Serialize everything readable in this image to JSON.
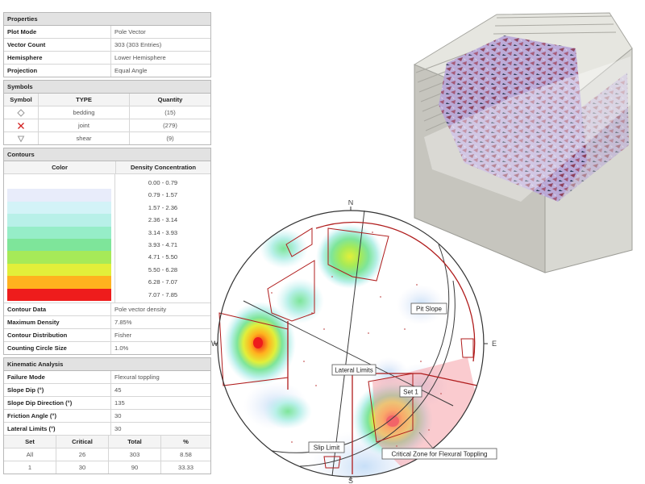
{
  "properties": {
    "title": "Properties",
    "rows": [
      {
        "key": "Plot Mode",
        "value": "Pole Vector"
      },
      {
        "key": "Vector Count",
        "value": "303 (303 Entries)"
      },
      {
        "key": "Hemisphere",
        "value": "Lower Hemisphere"
      },
      {
        "key": "Projection",
        "value": "Equal Angle"
      }
    ]
  },
  "symbols": {
    "title": "Symbols",
    "headers": [
      "Symbol",
      "TYPE",
      "Quantity"
    ],
    "rows": [
      {
        "icon": "diamond-outline-icon",
        "type": "bedding",
        "quantity": "(15)",
        "color": "#999999"
      },
      {
        "icon": "red-x-icon",
        "type": "joint",
        "quantity": "(279)",
        "color": "#d22020"
      },
      {
        "icon": "triangle-down-outline-icon",
        "type": "shear",
        "quantity": "(9)",
        "color": "#999999"
      }
    ]
  },
  "contours": {
    "title": "Contours",
    "headers": [
      "Color",
      "Density Concentration"
    ],
    "bins": [
      {
        "color": "#ffffff",
        "range": "0.00 - 0.79"
      },
      {
        "color": "#e8ecfa",
        "range": "0.79 - 1.57"
      },
      {
        "color": "#d3f3f7",
        "range": "1.57 - 2.36"
      },
      {
        "color": "#b8f0e8",
        "range": "2.36 - 3.14"
      },
      {
        "color": "#96edc8",
        "range": "3.14 - 3.93"
      },
      {
        "color": "#7ee59a",
        "range": "3.93 - 4.71"
      },
      {
        "color": "#a6ea58",
        "range": "4.71 - 5.50"
      },
      {
        "color": "#e2ef3a",
        "range": "5.50 - 6.28"
      },
      {
        "color": "#ffb21e",
        "range": "6.28 - 7.07"
      },
      {
        "color": "#ee1c1c",
        "range": "7.07 - 7.85"
      }
    ],
    "rows": [
      {
        "key": "Contour Data",
        "value": "Pole vector density"
      },
      {
        "key": "Maximum Density",
        "value": "7.85%"
      },
      {
        "key": "Contour Distribution",
        "value": "Fisher"
      },
      {
        "key": "Counting Circle Size",
        "value": "1.0%"
      }
    ]
  },
  "kinematic": {
    "title": "Kinematic Analysis",
    "rows": [
      {
        "key": "Failure Mode",
        "value": "Flexural toppling"
      },
      {
        "key": "Slope Dip (°)",
        "value": "45"
      },
      {
        "key": "Slope Dip Direction (°)",
        "value": "135"
      },
      {
        "key": "Friction Angle (°)",
        "value": "30"
      },
      {
        "key": "Lateral Limits (°)",
        "value": "30"
      }
    ],
    "table_headers": [
      "Set",
      "Critical",
      "Total",
      "%"
    ],
    "table_rows": [
      [
        "All",
        "26",
        "303",
        "8.58"
      ],
      [
        "1",
        "30",
        "90",
        "33.33"
      ]
    ]
  },
  "stereonet": {
    "directions": {
      "n": "N",
      "e": "E",
      "s": "S",
      "w": "W"
    },
    "labels": {
      "pit_slope": "Pit Slope",
      "lateral_limits": "Lateral Limits",
      "set1": "Set 1",
      "slip_limit": "Slip Limit",
      "critical_zone": "Critical Zone for Flexural Toppling"
    }
  }
}
